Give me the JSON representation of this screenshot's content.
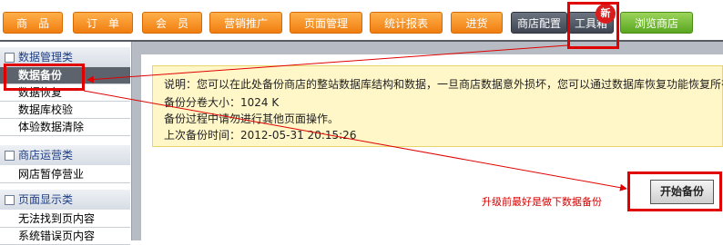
{
  "nav": {
    "items": [
      {
        "label": "商　品",
        "style": "orange"
      },
      {
        "label": "订　单",
        "style": "orange"
      },
      {
        "label": "会　员",
        "style": "orange"
      },
      {
        "label": "营销推广",
        "style": "orange"
      },
      {
        "label": "页面管理",
        "style": "orange"
      },
      {
        "label": "统计报表",
        "style": "orange"
      },
      {
        "label": "进货",
        "style": "orange"
      },
      {
        "label": "商店配置",
        "style": "gray"
      },
      {
        "label": "工具箱",
        "style": "gray"
      },
      {
        "label": "浏览商店",
        "style": "green"
      }
    ],
    "badge": "新"
  },
  "sidebar": {
    "sections": [
      {
        "title": "数据管理类",
        "items": [
          "数据备份",
          "数据恢复",
          "数据库校验",
          "体验数据清除"
        ]
      },
      {
        "title": "商店运营类",
        "items": [
          "网店暂停营业"
        ]
      },
      {
        "title": "页面显示类",
        "items": [
          "无法找到页内容",
          "系统错误页内容"
        ]
      }
    ]
  },
  "notice": {
    "line1": "说明：您可以在此处备份商店的整站数据库结构和数据，一旦商店数据意外损坏，您可以通过数据库恢复功能恢复所有",
    "line2": "备份分卷大小：1024 K",
    "line3": "备份过程中请勿进行其他页面操作。",
    "line4": "上次备份时间：2012-05-31 20:15:26"
  },
  "actions": {
    "start_label": "开始备份",
    "hint": "升级前最好是做下数据备份"
  },
  "colors": {
    "accent_orange": "#f07d10",
    "annotation_red": "#e00000"
  }
}
